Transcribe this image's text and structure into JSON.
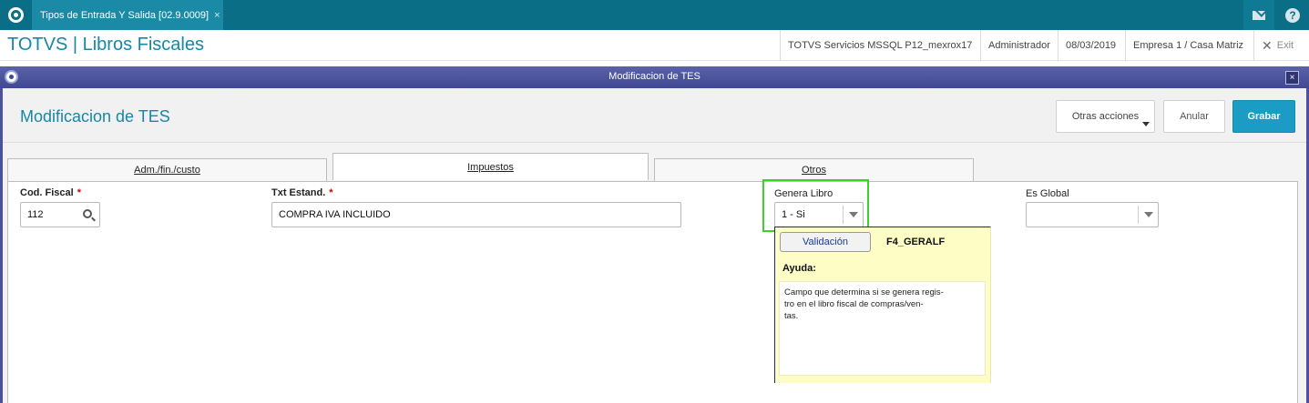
{
  "topbar": {
    "tab_label": "Tipos de Entrada Y Salida [02.9.0009]",
    "tab_close": "×",
    "help_glyph": "?"
  },
  "header": {
    "app_title": "TOTVS | Libros Fiscales",
    "environment": "TOTVS Servicios MSSQL P12_mexrox17",
    "user": "Administrador",
    "date": "08/03/2019",
    "company": "Empresa 1 / Casa Matriz",
    "exit_glyph": "✕",
    "exit_label": "Exit"
  },
  "dialog": {
    "title": "Modificacion de TES",
    "close_glyph": "×",
    "form_title": "Modificacion de TES",
    "actions": {
      "otras": "Otras acciones",
      "anular": "Anular",
      "grabar": "Grabar"
    },
    "tabs": [
      {
        "label": "Adm./fin./custo"
      },
      {
        "label": "Impuestos"
      },
      {
        "label": "Otros"
      }
    ],
    "fields": {
      "cod_fiscal": {
        "label": "Cod. Fiscal",
        "required": "*",
        "value": "112"
      },
      "txt_estand": {
        "label": "Txt Estand.",
        "required": "*",
        "value": "COMPRA IVA INCLUIDO"
      },
      "genera_libro": {
        "label": "Genera Libro",
        "value": "1 - Si"
      },
      "es_global": {
        "label": "Es Global",
        "value": ""
      }
    },
    "help": {
      "validacion_button": "Validación",
      "field_code": "F4_GERALF",
      "ayuda_label": "Ayuda:",
      "text": "Campo que determina si se genera regis-\ntro en el libro fiscal de compras/ven-\ntas."
    }
  },
  "colors": {
    "topbar": "#0b6e87",
    "accent": "#1787a6",
    "dialog_title": "#4a52a0",
    "grabar": "#1a9cc4",
    "highlight": "#3ed12d"
  }
}
